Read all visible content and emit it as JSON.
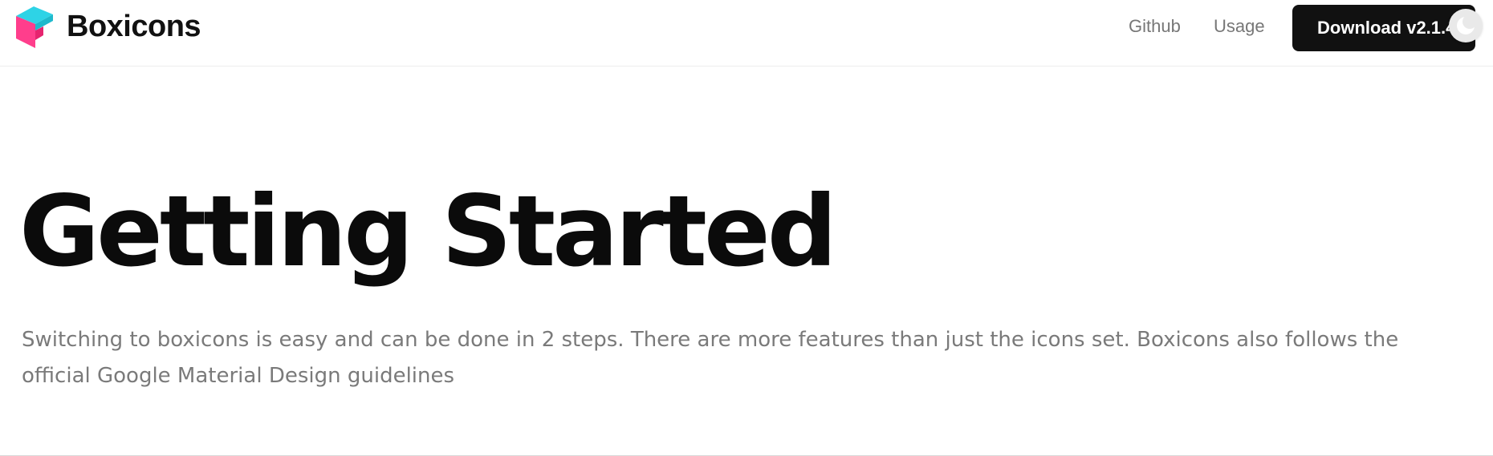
{
  "navbar": {
    "brand_name": "Boxicons",
    "logo_icon": "boxicons-logo-icon",
    "links": {
      "github": "Github",
      "usage": "Usage"
    },
    "download_label": "Download v2.1.4",
    "theme_toggle_icon": "moon-icon"
  },
  "hero": {
    "title": "Getting Started",
    "description": "Switching to boxicons is easy and can be done in 2 steps. There are more features than just the icons set. Boxicons also follows the official Google Material Design guidelines"
  },
  "colors": {
    "logo_cyan": "#2ed3e6",
    "logo_pink": "#ff3e8c",
    "logo_dark_pink": "#e6246f",
    "button_bg": "#111111",
    "text_muted": "#7a7a7a"
  }
}
